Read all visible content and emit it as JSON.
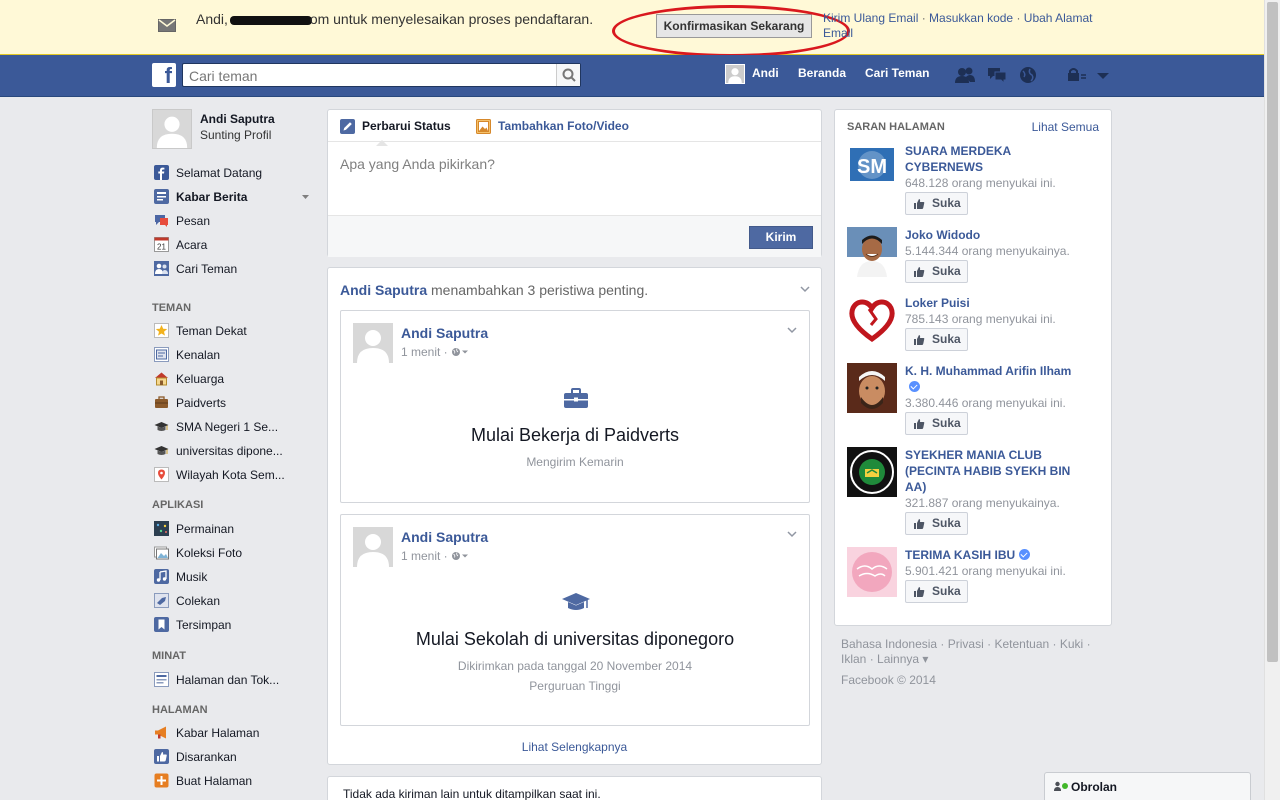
{
  "confirm_bar": {
    "greeting": "Andi,",
    "email_suffix": "om untuk menyelesaikan proses pendaftaran.",
    "confirm_button": "Konfirmasikan Sekarang",
    "link_resend": "Kirim Ulang Email",
    "link_enter_code": "Masukkan kode",
    "link_change_email": "Ubah Alamat Email",
    "separator": "·"
  },
  "header": {
    "logo": "f",
    "search_placeholder": "Cari teman",
    "user_name": "Andi",
    "home": "Beranda",
    "find_friends": "Cari Teman"
  },
  "left_nav": {
    "profile_name": "Andi Saputra",
    "edit_profile": "Sunting Profil",
    "main_items": [
      {
        "label": "Selamat Datang",
        "icon": "facebook-icon"
      },
      {
        "label": "Kabar Berita",
        "icon": "news-feed-icon"
      },
      {
        "label": "Pesan",
        "icon": "message-icon"
      },
      {
        "label": "Acara",
        "icon": "calendar-icon",
        "badge": "21"
      },
      {
        "label": "Cari Teman",
        "icon": "friends-icon"
      }
    ],
    "friends_header": "TEMAN",
    "friends_items": [
      {
        "label": "Teman Dekat",
        "icon": "star-icon"
      },
      {
        "label": "Kenalan",
        "icon": "acquaintance-icon"
      },
      {
        "label": "Keluarga",
        "icon": "house-icon"
      },
      {
        "label": "Paidverts",
        "icon": "briefcase-icon"
      },
      {
        "label": "SMA Negeri 1 Se...",
        "icon": "school-icon"
      },
      {
        "label": "universitas dipone...",
        "icon": "graduation-icon"
      },
      {
        "label": "Wilayah Kota Sem...",
        "icon": "location-icon"
      }
    ],
    "apps_header": "APLIKASI",
    "apps_items": [
      {
        "label": "Permainan",
        "icon": "games-icon"
      },
      {
        "label": "Koleksi Foto",
        "icon": "photos-icon"
      },
      {
        "label": "Musik",
        "icon": "music-icon"
      },
      {
        "label": "Colekan",
        "icon": "poke-icon"
      },
      {
        "label": "Tersimpan",
        "icon": "bookmark-icon"
      }
    ],
    "interests_header": "MINAT",
    "interests_items": [
      {
        "label": "Halaman dan Tok...",
        "icon": "pages-feed-icon"
      }
    ],
    "pages_header": "HALAMAN",
    "pages_items": [
      {
        "label": "Kabar Halaman",
        "icon": "megaphone-icon"
      },
      {
        "label": "Disarankan",
        "icon": "thumbs-up-icon"
      },
      {
        "label": "Buat Halaman",
        "icon": "create-page-icon"
      }
    ]
  },
  "composer": {
    "tab_status": "Perbarui Status",
    "tab_photo": "Tambahkan Foto/Video",
    "placeholder": "Apa yang Anda pikirkan?",
    "post_button": "Kirim"
  },
  "story": {
    "actor": "Andi Saputra",
    "action": " menambahkan 3 peristiwa penting.",
    "events": [
      {
        "name": "Andi Saputra",
        "time": "1 menit ·",
        "title": "Mulai Bekerja di Paidverts",
        "meta1": "Mengirim Kemarin",
        "meta2": ""
      },
      {
        "name": "Andi Saputra",
        "time": "1 menit ·",
        "title": "Mulai Sekolah di universitas diponegoro",
        "meta1": "Dikirimkan pada tanggal 20 November 2014",
        "meta2": "Perguruan Tinggi"
      }
    ],
    "see_more": "Lihat Selengkapnya"
  },
  "no_posts": "Tidak ada kiriman lain untuk ditampilkan saat ini.",
  "suggested_pages": {
    "header": "SARAN HALAMAN",
    "see_all": "Lihat Semua",
    "like_label": "Suka",
    "items": [
      {
        "name": "SUARA MERDEKA CYBERNEWS",
        "likes": "648.128 orang menyukai ini.",
        "verified": false
      },
      {
        "name": "Joko Widodo",
        "likes": "5.144.344 orang menyukainya.",
        "verified": false
      },
      {
        "name": "Loker Puisi",
        "likes": "785.143 orang menyukai ini.",
        "verified": false
      },
      {
        "name": "K. H. Muhammad Arifin Ilham",
        "likes": "3.380.446 orang menyukai ini.",
        "verified": true
      },
      {
        "name": "SYEKHER MANIA CLUB (PECINTA HABIB SYEKH BIN AA)",
        "likes": "321.887 orang menyukainya.",
        "verified": false
      },
      {
        "name": "TERIMA KASIH IBU",
        "likes": "5.901.421 orang menyukai ini.",
        "verified": true
      }
    ]
  },
  "footer": {
    "links": [
      "Bahasa Indonesia",
      "Privasi",
      "Ketentuan",
      "Kuki",
      "Iklan",
      "Lainnya ▾"
    ],
    "copyright": "Facebook © 2014"
  },
  "chat": {
    "label": "Obrolan"
  },
  "colors": {
    "brand_blue": "#3b5998",
    "confirm_bg": "#fff9d7",
    "highlight_red": "#d9181e",
    "online_green": "#42b72a"
  }
}
